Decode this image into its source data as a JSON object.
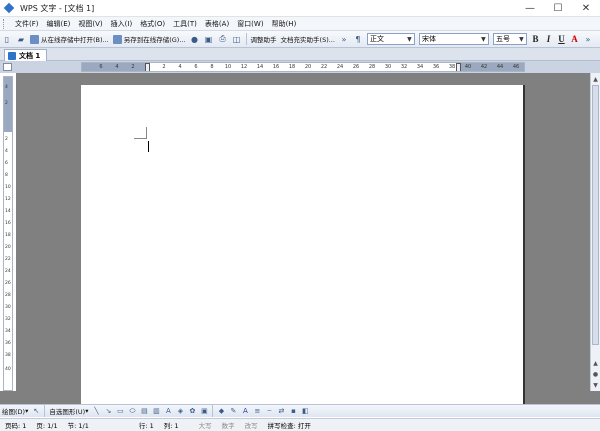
{
  "window": {
    "title": "WPS 文字 - [文档 1]",
    "controls": {
      "minimize": "—",
      "maximize": "☐",
      "close": "✕"
    }
  },
  "menubar": {
    "items": [
      "文件(F)",
      "编辑(E)",
      "视图(V)",
      "插入(I)",
      "格式(O)",
      "工具(T)",
      "表格(A)",
      "窗口(W)",
      "帮助(H)"
    ]
  },
  "toolbar": {
    "open_online": "从在线存储中打开(B)...",
    "save_online": "另存到在线存储(G)...",
    "adjust_helper": "调整助手",
    "doc_complete": "文档充实助手(S)...",
    "style_value": "正文",
    "font_value": "宋体",
    "size_value": "五号",
    "bold": "B",
    "italic": "I",
    "underline": "U",
    "font_color": "A"
  },
  "tabs": {
    "doc_tab": "文档 1"
  },
  "ruler": {
    "h_labels": [
      "6",
      "4",
      "2",
      "2",
      "4",
      "6",
      "8",
      "10",
      "12",
      "14",
      "16",
      "18",
      "20",
      "22",
      "24",
      "26",
      "28",
      "30",
      "32",
      "34",
      "36",
      "38",
      "40",
      "42",
      "44",
      "46"
    ],
    "v_labels": [
      "4",
      "2",
      "2",
      "4",
      "6",
      "8",
      "10",
      "12",
      "14",
      "16",
      "18",
      "20",
      "22",
      "24",
      "26",
      "28",
      "30",
      "32",
      "34",
      "36",
      "38",
      "40"
    ]
  },
  "drawbar": {
    "draw_label": "绘图(D)",
    "autoshape_label": "自选图形(U)"
  },
  "status": {
    "page_num": "页码: 1",
    "page": "页: 1/1",
    "section": "节: 1/1",
    "row": "行: 1",
    "col": "列: 1",
    "caps": "大写",
    "num": "数字",
    "overwrite": "改写",
    "spellcheck": "拼写检查: 打开"
  }
}
